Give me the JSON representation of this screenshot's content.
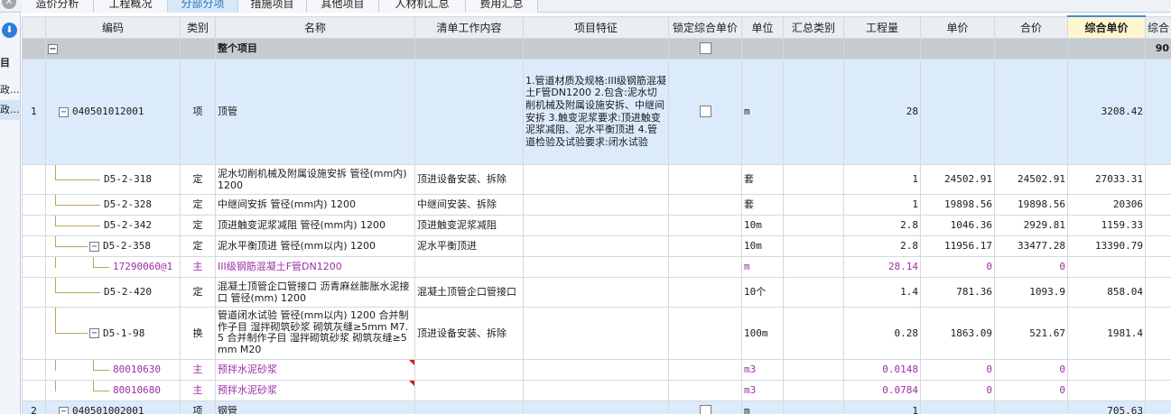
{
  "tabs": [
    "造价分析",
    "工程概况",
    "分部分项",
    "措施项目",
    "其他项目",
    "人材机汇总",
    "费用汇总"
  ],
  "active_tab": 2,
  "left_panel": {
    "items": [
      "目",
      "政...",
      "政..."
    ]
  },
  "columns": [
    "编码",
    "类别",
    "名称",
    "清单工作内容",
    "项目特征",
    "锁定综合单价",
    "单位",
    "汇总类别",
    "工程量",
    "单价",
    "合价",
    "综合单价",
    "综合"
  ],
  "whole_row": {
    "toggle": "−",
    "name": "整个项目",
    "tail": "90"
  },
  "item1": {
    "index": "1",
    "code": "040501012001",
    "type": "项",
    "name": "顶管",
    "features": "1.管道材质及规格:III级钢筋混凝土F管DN1200 2.包含:泥水切削机械及附属设施安拆、中继间安拆 3.触变泥浆要求:顶进触变泥浆减阻、泥水平衡顶进 4.管道检验及试验要求:闭水试验",
    "unit": "m",
    "qty": "28",
    "composite": "3208.42"
  },
  "rows": [
    {
      "code": "D5-2-318",
      "type": "定",
      "name": "泥水切削机械及附属设施安拆 管径(mm内) 1200",
      "work": "顶进设备安装、拆除",
      "unit": "套",
      "qty": "1",
      "price": "24502.91",
      "total": "24502.91",
      "composite": "27033.31"
    },
    {
      "code": "D5-2-328",
      "type": "定",
      "name": "中继间安拆 管径(mm内) 1200",
      "work": "中继间安装、拆除",
      "unit": "套",
      "qty": "1",
      "price": "19898.56",
      "total": "19898.56",
      "composite": "20306"
    },
    {
      "code": "D5-2-342",
      "type": "定",
      "name": "顶进触变泥浆减阻 管径(mm内) 1200",
      "work": "顶进触变泥浆减阻",
      "unit": "10m",
      "qty": "2.8",
      "price": "1046.36",
      "total": "2929.81",
      "composite": "1159.33"
    },
    {
      "code": "D5-2-358",
      "type": "定",
      "name": "泥水平衡顶进 管径(mm以内) 1200",
      "work": "泥水平衡顶进",
      "unit": "10m",
      "qty": "2.8",
      "price": "11956.17",
      "total": "33477.28",
      "composite": "13390.79"
    },
    {
      "code": "17290060@1",
      "type": "主",
      "name": "III级钢筋混凝土F管DN1200",
      "work": "",
      "unit": "m",
      "qty": "28.14",
      "price": "0",
      "total": "0",
      "composite": ""
    },
    {
      "code": "D5-2-420",
      "type": "定",
      "name": "混凝土顶管企口管接口 沥青麻丝膨胀水泥接口 管径(mm) 1200",
      "work": "混凝土顶管企口管接口",
      "unit": "10个",
      "qty": "1.4",
      "price": "781.36",
      "total": "1093.9",
      "composite": "858.04"
    },
    {
      "code": "D5-1-98",
      "type": "换",
      "name": "管道闭水试验 管径(mm以内) 1200 合并制作子目 湿拌砌筑砂浆 砌筑灰缝≥5mm M7.5 合并制作子目 湿拌砌筑砂浆 砌筑灰缝≥5mm M20",
      "work": "顶进设备安装、拆除",
      "unit": "100m",
      "qty": "0.28",
      "price": "1863.09",
      "total": "521.67",
      "composite": "1981.4"
    },
    {
      "code": "80010630",
      "type": "主",
      "name": "预拌水泥砂浆",
      "work": "",
      "unit": "m3",
      "qty": "0.0148",
      "price": "0",
      "total": "0",
      "composite": ""
    },
    {
      "code": "80010680",
      "type": "主",
      "name": "预拌水泥砂浆",
      "work": "",
      "unit": "m3",
      "qty": "0.0784",
      "price": "0",
      "total": "0",
      "composite": ""
    }
  ],
  "item2": {
    "index": "2",
    "code": "040501002001",
    "type": "项",
    "name": "钢管",
    "unit": "m",
    "qty": "1",
    "composite": "705.63"
  }
}
